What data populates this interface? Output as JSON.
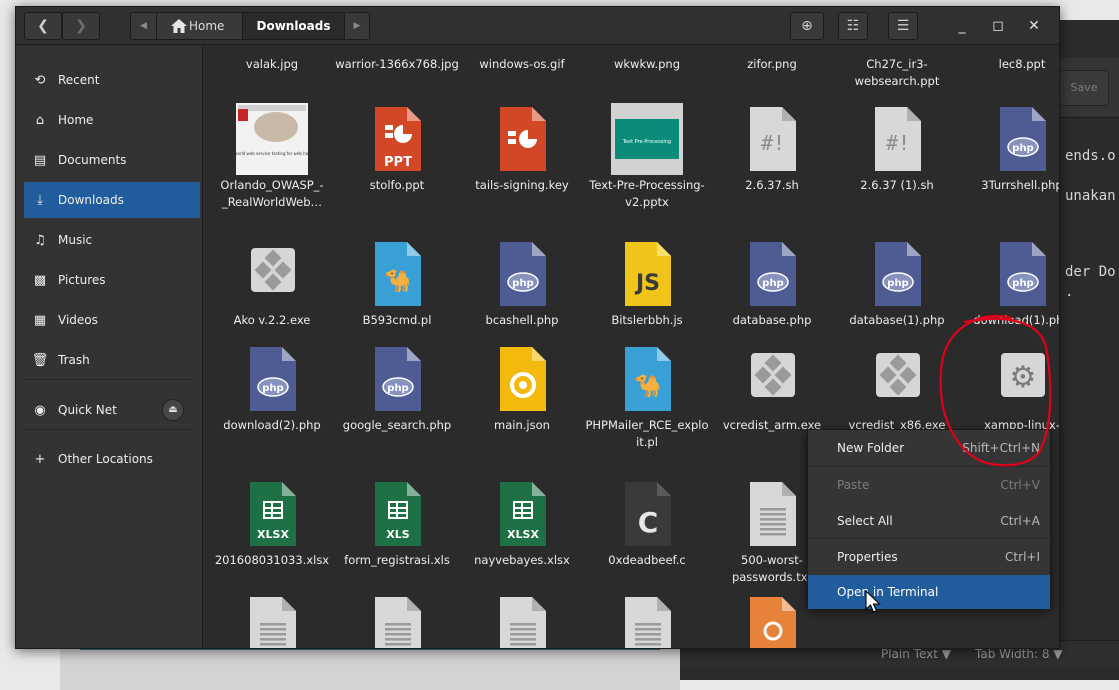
{
  "background_editor": {
    "save_label": "Save",
    "code_lines": [
      "ends.o",
      "unakan",
      "der Do",
      "."
    ],
    "status": {
      "syntax": "Plain Text ▼",
      "tab_width": "Tab Width: 8 ▼"
    }
  },
  "toolbar": {
    "back_glyph": "❮",
    "forward_glyph": "❯",
    "crumb_left_glyph": "◀",
    "crumb_right_glyph": "▶",
    "home_label": "Home",
    "current_folder": "Downloads",
    "location_glyph": "⊕",
    "list_glyph": "☷",
    "menu_glyph": "☰",
    "minimize_glyph": "_",
    "maximize_glyph": "◻",
    "close_glyph": "✕"
  },
  "sidebar": {
    "items": [
      {
        "label": "Recent",
        "icon": "clock-icon",
        "glyph": "⟲"
      },
      {
        "label": "Home",
        "icon": "home-icon",
        "glyph": "⌂"
      },
      {
        "label": "Documents",
        "icon": "document-icon",
        "glyph": "▤"
      },
      {
        "label": "Downloads",
        "icon": "download-icon",
        "glyph": "⤓"
      },
      {
        "label": "Music",
        "icon": "music-icon",
        "glyph": "♫"
      },
      {
        "label": "Pictures",
        "icon": "pictures-icon",
        "glyph": "▩"
      },
      {
        "label": "Videos",
        "icon": "videos-icon",
        "glyph": "▦"
      },
      {
        "label": "Trash",
        "icon": "trash-icon",
        "glyph": "🗑"
      },
      {
        "label": "Quick Net",
        "icon": "drive-icon",
        "glyph": "◉"
      },
      {
        "label": "Other Locations",
        "icon": "plus-icon",
        "glyph": "+"
      }
    ],
    "eject_glyph": "⏏"
  },
  "files": [
    {
      "name": "valak.jpg",
      "type": "none"
    },
    {
      "name": "warrior-1366x768.jpg",
      "type": "none"
    },
    {
      "name": "windows-os.gif",
      "type": "none"
    },
    {
      "name": "wkwkw.png",
      "type": "none"
    },
    {
      "name": "zifor.png",
      "type": "none"
    },
    {
      "name": "Ch27c_ir3-websearch.ppt",
      "type": "none"
    },
    {
      "name": "lec8.ppt",
      "type": "none"
    },
    {
      "name": "Orlando_OWASP_-_RealWorldWeb…",
      "type": "pdf-thumb",
      "thumb_text": "real world web service testing for web hackers"
    },
    {
      "name": "stolfo.ppt",
      "type": "ppt",
      "badge": "PPT"
    },
    {
      "name": "tails-signing.key",
      "type": "key"
    },
    {
      "name": "Text-Pre-Processing-v2.pptx",
      "type": "slide-thumb",
      "thumb_text": "Text Pre-Processing"
    },
    {
      "name": "2.6.37.sh",
      "type": "script",
      "badge": "#!"
    },
    {
      "name": "2.6.37 (1).sh",
      "type": "script",
      "badge": "#!"
    },
    {
      "name": "3Turrshell.php",
      "type": "php",
      "badge": "php"
    },
    {
      "name": "Ako v.2.2.exe",
      "type": "exe"
    },
    {
      "name": "B593cmd.pl",
      "type": "perl"
    },
    {
      "name": "bcashell.php",
      "type": "php",
      "badge": "php"
    },
    {
      "name": "Bitslerbbh.js",
      "type": "js",
      "badge": "JS"
    },
    {
      "name": "database.php",
      "type": "php",
      "badge": "php"
    },
    {
      "name": "database(1).php",
      "type": "php",
      "badge": "php"
    },
    {
      "name": "download(1).php",
      "type": "php",
      "badge": "php"
    },
    {
      "name": "download(2).php",
      "type": "php",
      "badge": "php"
    },
    {
      "name": "google_search.php",
      "type": "php",
      "badge": "php"
    },
    {
      "name": "main.json",
      "type": "json"
    },
    {
      "name": "PHPMailer_RCE_exploit.pl",
      "type": "perl"
    },
    {
      "name": "vcredist_arm.exe",
      "type": "exe"
    },
    {
      "name": "vcredist_x86.exe",
      "type": "exe"
    },
    {
      "name": "xampp-linux-",
      "type": "gear"
    },
    {
      "name": "201608031033.xlsx",
      "type": "sheet",
      "badge": "XLSX"
    },
    {
      "name": "form_registrasi.xls",
      "type": "sheet",
      "badge": "XLS"
    },
    {
      "name": "nayvebayes.xlsx",
      "type": "sheet",
      "badge": "XLSX"
    },
    {
      "name": "0xdeadbeef.c",
      "type": "c-src",
      "badge": "C"
    },
    {
      "name": "500-worst-passwords.txt",
      "type": "text"
    },
    {
      "name": "",
      "type": "python"
    },
    {
      "name": "",
      "type": "python"
    },
    {
      "name": "",
      "type": "text"
    },
    {
      "name": "",
      "type": "text"
    },
    {
      "name": "",
      "type": "text"
    },
    {
      "name": "",
      "type": "text"
    },
    {
      "name": "",
      "type": "cert"
    }
  ],
  "context_menu": {
    "items": [
      {
        "label": "New Folder",
        "accel": "Shift+Ctrl+N",
        "state": "normal"
      },
      {
        "label": "Paste",
        "accel": "Ctrl+V",
        "state": "disabled"
      },
      {
        "label": "Select All",
        "accel": "Ctrl+A",
        "state": "normal"
      },
      {
        "label": "Properties",
        "accel": "Ctrl+I",
        "state": "normal"
      },
      {
        "label": "Open in Terminal",
        "accel": "",
        "state": "highlighted"
      }
    ]
  },
  "colors": {
    "accent": "#215d9c",
    "php": "#4f5b93",
    "ppt": "#d24726",
    "sheet": "#1e7145",
    "js": "#f0c419",
    "perl": "#39a0d6",
    "json": "#f3b90f",
    "python": "#3774a6",
    "annotation": "#e1001a"
  }
}
